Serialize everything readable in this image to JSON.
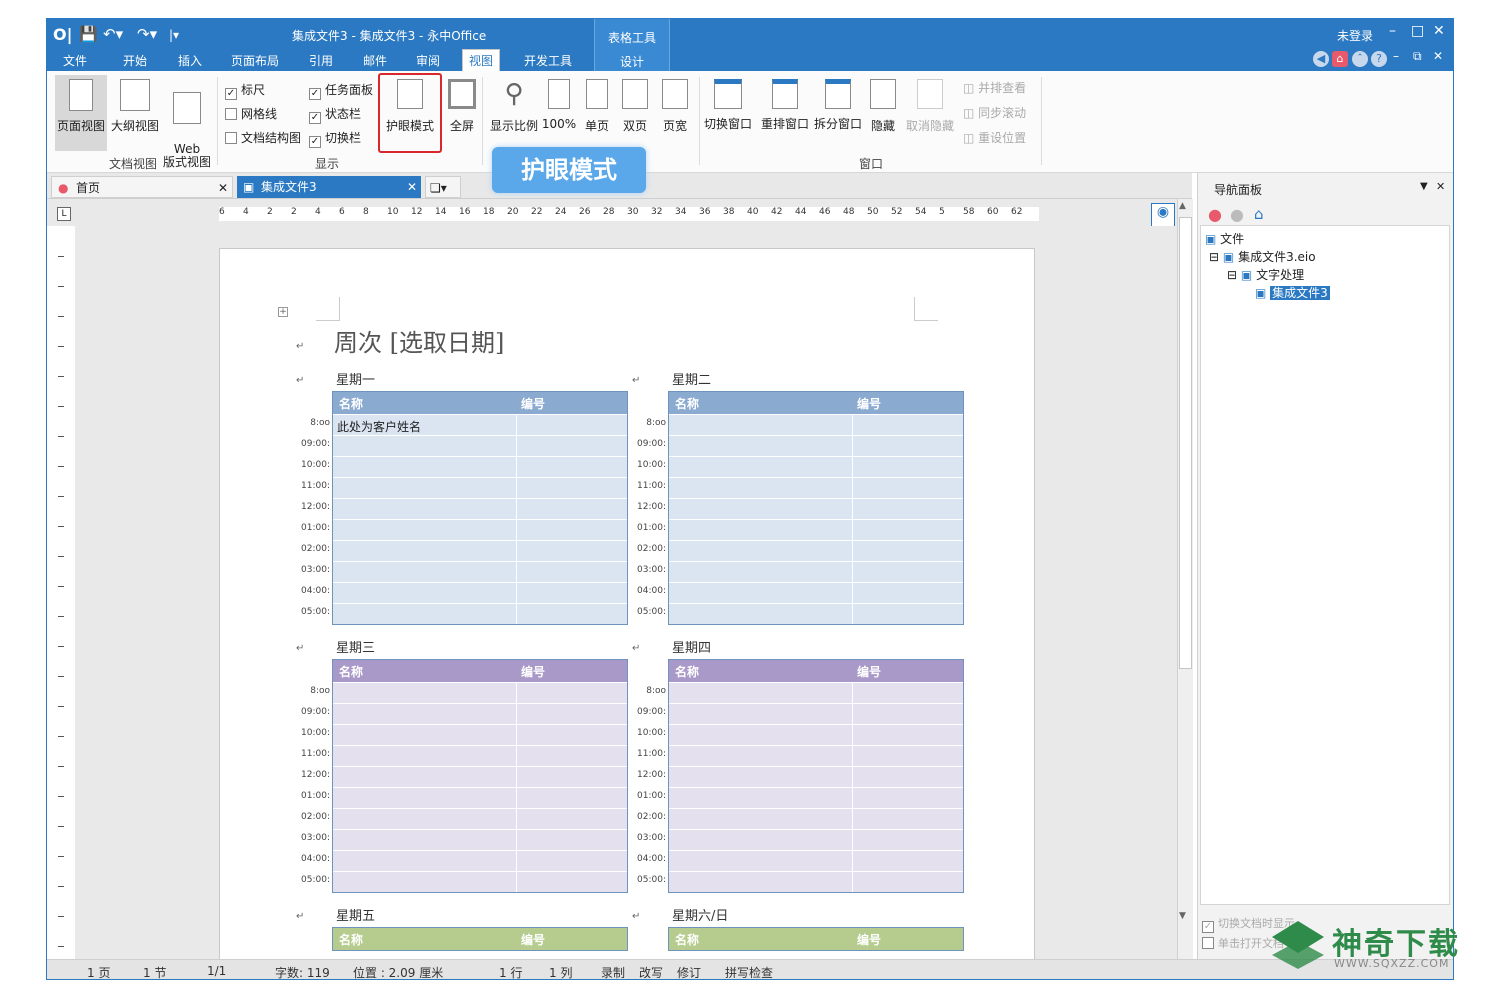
{
  "window": {
    "title": "集成文件3 - 集成文件3 - 永中Office",
    "context_tab": {
      "group": "表格工具",
      "tab": "设计"
    },
    "login": "未登录"
  },
  "menu_tabs": [
    "文件",
    "开始",
    "插入",
    "页面布局",
    "引用",
    "邮件",
    "审阅",
    "视图",
    "开发工具"
  ],
  "active_tab": "视图",
  "ribbon": {
    "doc_views": {
      "label": "文档视图",
      "items": [
        "页面视图",
        "大纲视图",
        "Web\n版式视图"
      ]
    },
    "show": {
      "label": "显示",
      "checks": [
        {
          "label": "标尺",
          "checked": true
        },
        {
          "label": "网格线",
          "checked": false
        },
        {
          "label": "文档结构图",
          "checked": false
        },
        {
          "label": "任务面板",
          "checked": true
        },
        {
          "label": "状态栏",
          "checked": true
        },
        {
          "label": "切换栏",
          "checked": true
        }
      ]
    },
    "eye_mode": "护眼模式",
    "fullscreen": "全屏",
    "zoom_items": [
      "显示比例",
      "100%",
      "单页",
      "双页",
      "页宽"
    ],
    "window_group": {
      "label": "窗口",
      "items": [
        "切换窗口",
        "重排窗口",
        "拆分窗口",
        "隐藏",
        "取消隐藏"
      ],
      "side": [
        "并排查看",
        "同步滚动",
        "重设位置"
      ]
    }
  },
  "callout": "护眼模式",
  "doc_tabs": [
    {
      "label": "首页"
    },
    {
      "label": "集成文件3"
    }
  ],
  "ruler_labels": [
    "6",
    "4",
    "2",
    "2",
    "4",
    "6",
    "8",
    "10",
    "12",
    "14",
    "16",
    "18",
    "20",
    "22",
    "24",
    "26",
    "28",
    "30",
    "32",
    "34",
    "36",
    "38",
    "40",
    "42",
    "44",
    "46",
    "48",
    "50",
    "52",
    "54",
    "5",
    "58",
    "60",
    "62"
  ],
  "document": {
    "heading": "周次 [选取日期]",
    "col_name": "名称",
    "col_no": "编号",
    "sample": "此处为客户姓名",
    "days": [
      "星期一",
      "星期二",
      "星期三",
      "星期四",
      "星期五",
      "星期六/日"
    ],
    "times": [
      "8:oo",
      "09:00:",
      "10:00:",
      "11:00:",
      "12:00:",
      "01:00:",
      "02:00:",
      "03:00:",
      "04:00:",
      "05:00:"
    ]
  },
  "nav_panel": {
    "title": "导航面板",
    "tree": [
      "文件",
      "集成文件3.eio",
      "文字处理",
      "集成文件3"
    ],
    "options": [
      "切换文档时显示",
      "单击打开文档"
    ]
  },
  "status": [
    "1 页",
    "1 节",
    "1/1",
    "字数: 119",
    "位置 : 2.09 厘米",
    "1 行",
    "1 列",
    "录制",
    "改写",
    "修订",
    "拼写检查"
  ],
  "watermark": {
    "text": "神奇下载",
    "url": "WWW.SQXZZ.COM"
  },
  "colors": {
    "title_blue": "#2b79c2",
    "mon_header": "#8aaad0",
    "mon_body": "#dbe4f1",
    "wed_header": "#a999c8",
    "wed_body": "#e5e0ee",
    "fri_header": "#b5cc8e",
    "eye_border": "#d9272e"
  }
}
